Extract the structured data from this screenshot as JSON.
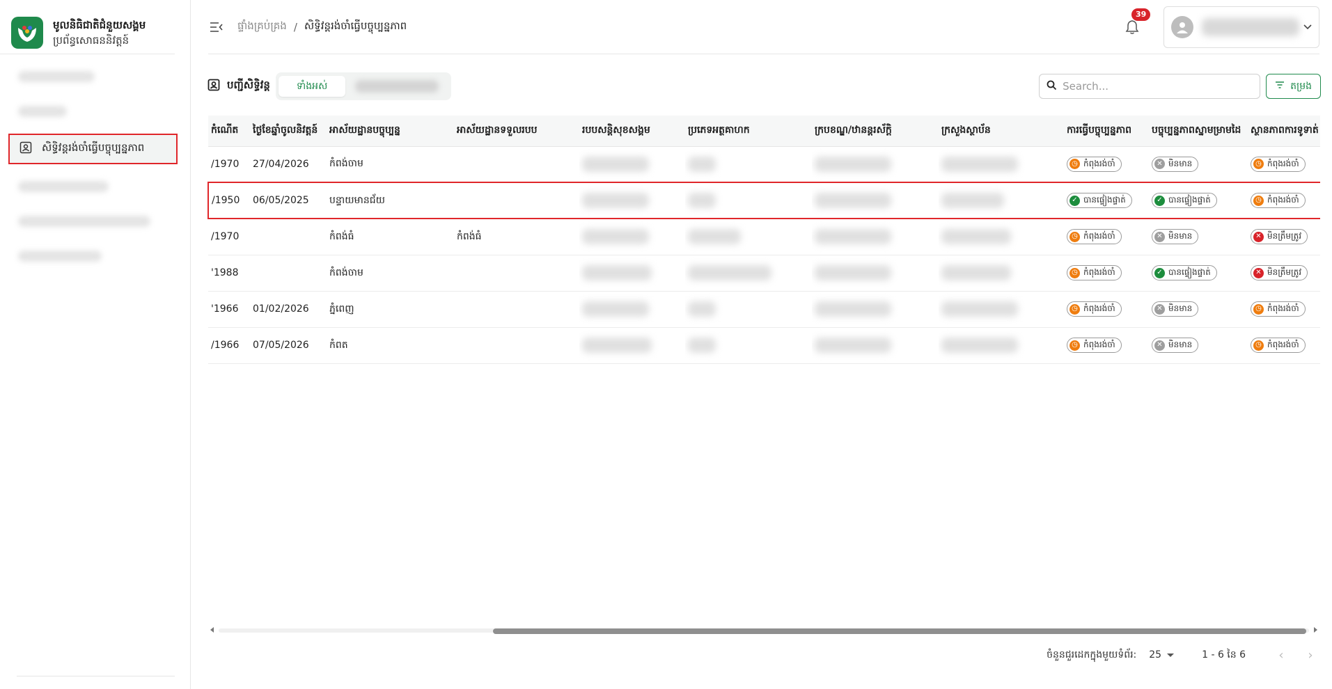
{
  "brand": {
    "title": "មូលនិធិជាតិជំនួយសង្គម",
    "subtitle": "ប្រព័ន្ធសោធននិវត្តន៍",
    "accent": "#1f8a4c"
  },
  "sidebar": {
    "active_item": {
      "label": "សិទ្ធិវន្តរង់ចាំធ្វើបច្ចុប្បន្នភាព",
      "icon": "person-badge-icon"
    }
  },
  "header": {
    "breadcrumb_root": "ផ្ទាំងគ្រប់គ្រង",
    "breadcrumb_sep": "/",
    "breadcrumb_current": "សិទ្ធិវន្តរង់ចាំធ្វើបច្ចុប្បន្នភាព",
    "notification_count": "39"
  },
  "toolbar": {
    "list_title": "បញ្ជីសិទ្ធិវន្ត",
    "tab_all": "ទាំងអស់",
    "search_placeholder": "Search...",
    "filter_label": "តម្រង"
  },
  "table": {
    "columns": [
      "កំណើត",
      "ថ្ងៃខែឆ្នាំចូលនិវត្តន៍",
      "អាស័យដ្ឋានបច្ចុប្បន្ន",
      "អាស័យដ្ឋានទទួលរបប",
      "របបសន្តិសុខសង្គម",
      "ប្រភេទអត្ថគាហក",
      "ក្របខណ្ឌ/ឋានន្តរស័ក្តិ",
      "ក្រសួងស្ថាប័ន",
      "ការធ្វើបច្ចុប្បន្នភាព",
      "បច្ចុប្បន្នភាពស្នាមម្រាមដៃ",
      "ស្ថានភាពការទូទាត់"
    ],
    "rows": [
      {
        "birth": "/1970",
        "retire_date": "27/04/2026",
        "address": "កំពង់ចាម",
        "receive_address": "",
        "update": {
          "text": "កំពុងរង់ចាំ",
          "kind": "orange"
        },
        "fingerprint": {
          "text": "មិនមាន",
          "kind": "gray"
        },
        "payment": {
          "text": "កំពុងរង់ចាំ",
          "kind": "orange"
        }
      },
      {
        "birth": "/1950",
        "retire_date": "06/05/2025",
        "address": "បន្ទាយមានជ័យ",
        "receive_address": "",
        "update": {
          "text": "បានផ្ទៀងផ្ទាត់",
          "kind": "green"
        },
        "fingerprint": {
          "text": "បានផ្ទៀងផ្ទាត់",
          "kind": "green"
        },
        "payment": {
          "text": "កំពុងរង់ចាំ",
          "kind": "orange"
        }
      },
      {
        "birth": "/1970",
        "retire_date": "",
        "address": "កំពង់ធំ",
        "receive_address": "កំពង់ធំ",
        "update": {
          "text": "កំពុងរង់ចាំ",
          "kind": "orange"
        },
        "fingerprint": {
          "text": "មិនមាន",
          "kind": "gray"
        },
        "payment": {
          "text": "មិនត្រឹមត្រូវ",
          "kind": "red"
        }
      },
      {
        "birth": "'1988",
        "retire_date": "",
        "address": "កំពង់ចាម",
        "receive_address": "",
        "update": {
          "text": "កំពុងរង់ចាំ",
          "kind": "orange"
        },
        "fingerprint": {
          "text": "បានផ្ទៀងផ្ទាត់",
          "kind": "green"
        },
        "payment": {
          "text": "មិនត្រឹមត្រូវ",
          "kind": "red"
        }
      },
      {
        "birth": "'1966",
        "retire_date": "01/02/2026",
        "address": "ភ្នំពេញ",
        "receive_address": "",
        "update": {
          "text": "កំពុងរង់ចាំ",
          "kind": "orange"
        },
        "fingerprint": {
          "text": "មិនមាន",
          "kind": "gray"
        },
        "payment": {
          "text": "កំពុងរង់ចាំ",
          "kind": "orange"
        }
      },
      {
        "birth": "/1966",
        "retire_date": "07/05/2026",
        "address": "កំពត",
        "receive_address": "",
        "update": {
          "text": "កំពុងរង់ចាំ",
          "kind": "orange"
        },
        "fingerprint": {
          "text": "មិនមាន",
          "kind": "gray"
        },
        "payment": {
          "text": "កំពុងរង់ចាំ",
          "kind": "orange"
        }
      }
    ]
  },
  "pagination": {
    "rows_per_page_label": "ចំនួនជួរដេកក្នុងមួយទំព័រ:",
    "rows_per_page": "25",
    "range": "1 - 6 នៃ 6"
  },
  "colors": {
    "status_orange": "#ef7d0f",
    "status_green": "#1d8d3d",
    "status_gray": "#9e9e9e",
    "status_red": "#d8232a",
    "highlight_border": "#e0262a"
  }
}
